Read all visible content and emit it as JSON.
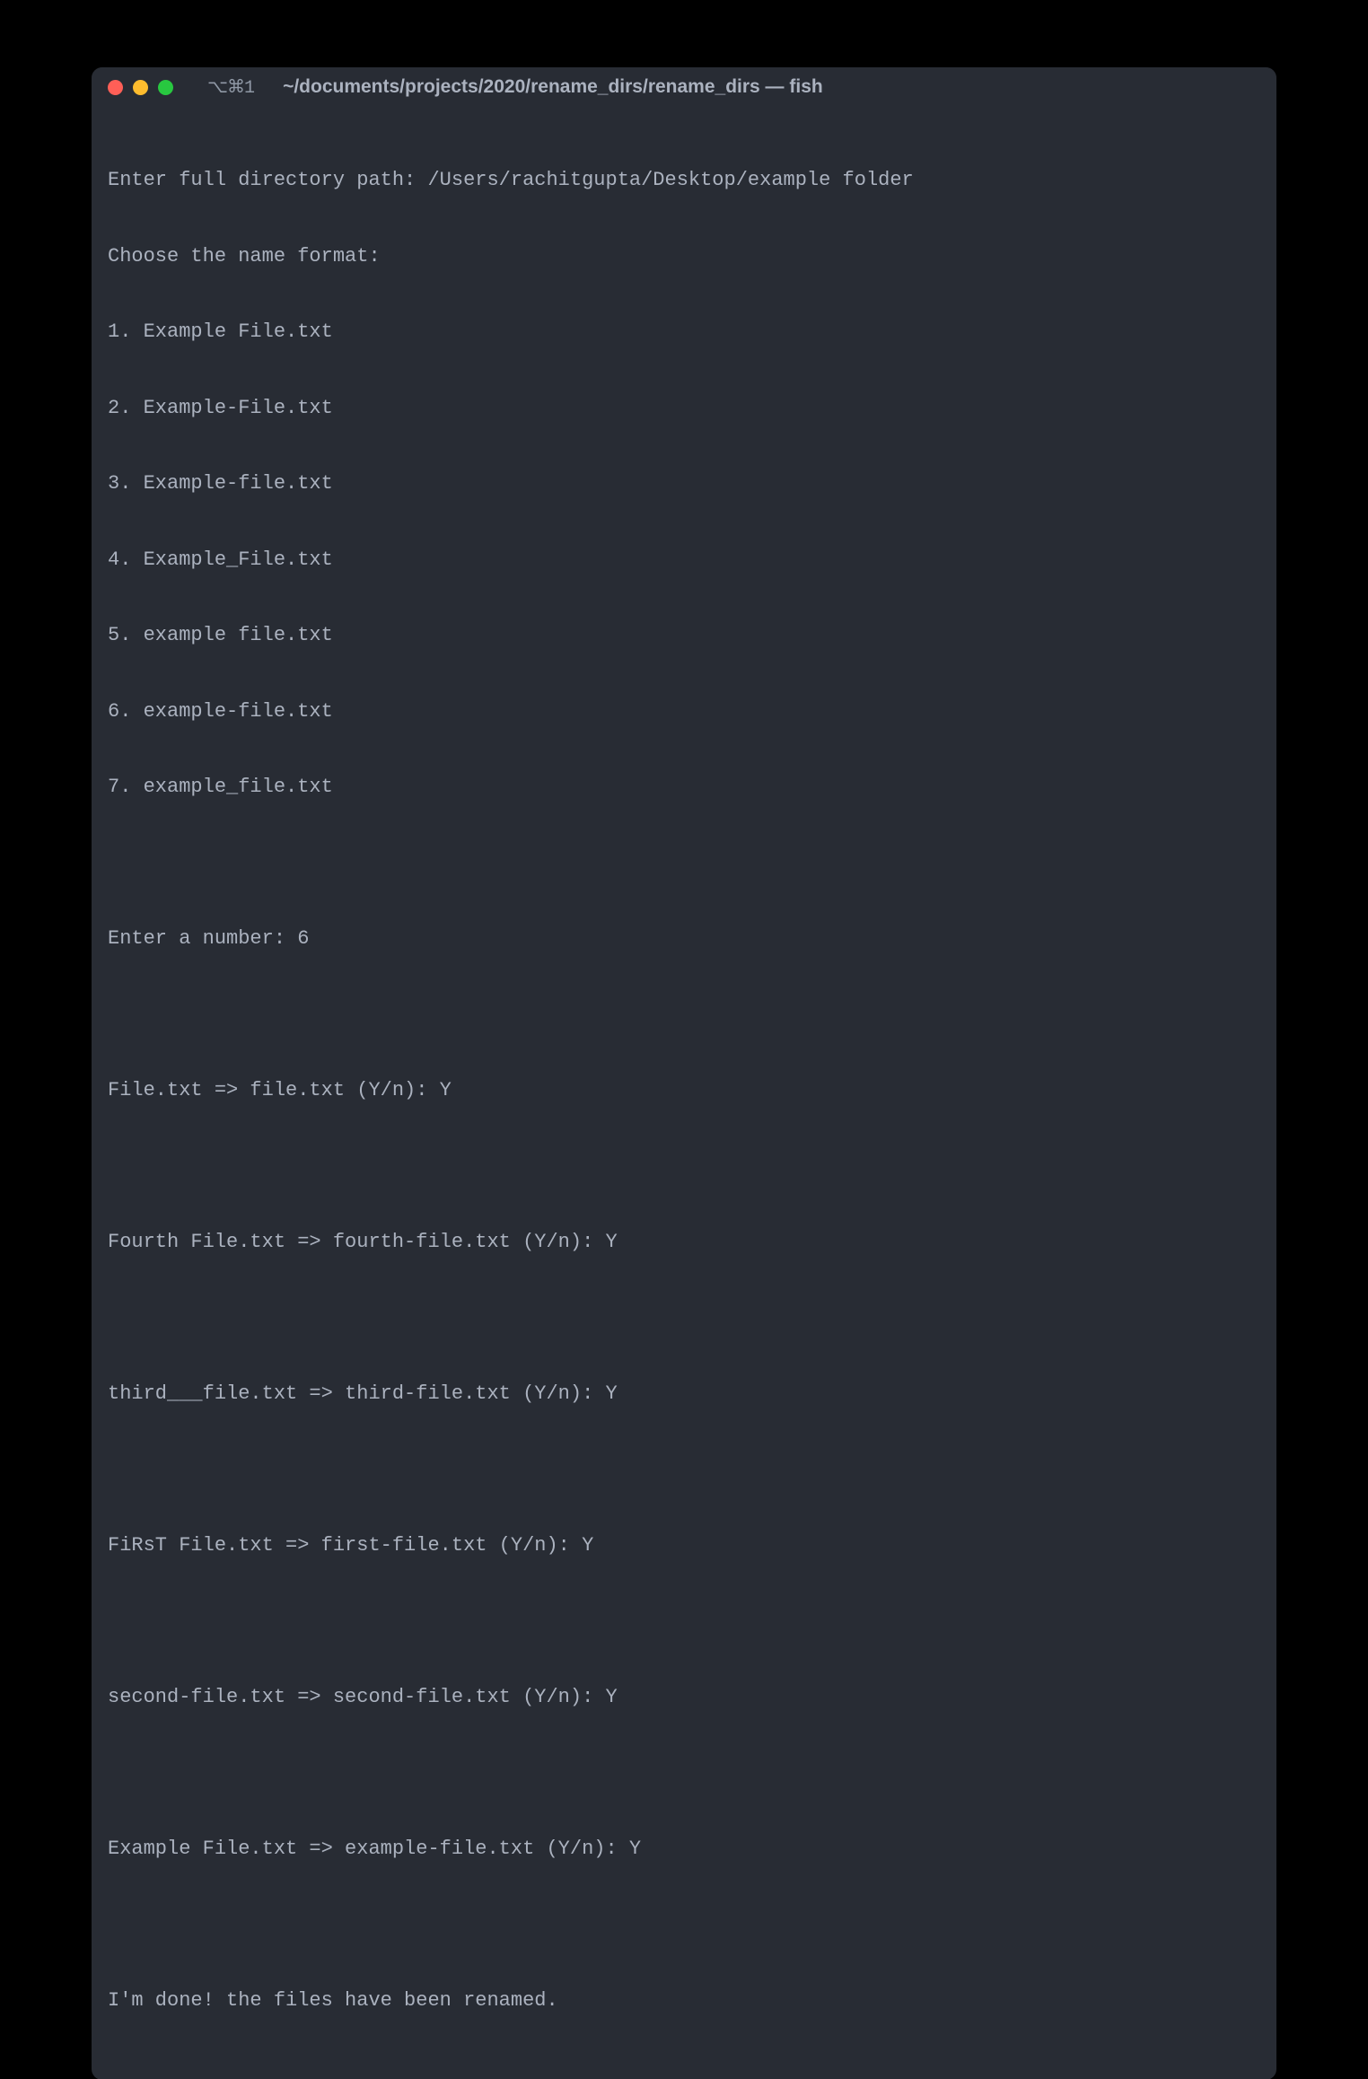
{
  "titlebar": {
    "shortcut": "⌥⌘1",
    "title": "~/documents/projects/2020/rename_dirs/rename_dirs — fish"
  },
  "lines": {
    "l0": "Enter full directory path: /Users/rachitgupta/Desktop/example folder",
    "l1": "Choose the name format:",
    "l2": "1. Example File.txt",
    "l3": "2. Example-File.txt",
    "l4": "3. Example-file.txt",
    "l5": "4. Example_File.txt",
    "l6": "5. example file.txt",
    "l7": "6. example-file.txt",
    "l8": "7. example_file.txt",
    "l9": "",
    "l10": "Enter a number: 6",
    "l11": "",
    "l12": "File.txt => file.txt (Y/n): Y",
    "l13": "",
    "l14": "Fourth File.txt => fourth-file.txt (Y/n): Y",
    "l15": "",
    "l16": "third___file.txt => third-file.txt (Y/n): Y",
    "l17": "",
    "l18": "FiRsT File.txt => first-file.txt (Y/n): Y",
    "l19": "",
    "l20": "second-file.txt => second-file.txt (Y/n): Y",
    "l21": "",
    "l22": "Example File.txt => example-file.txt (Y/n): Y",
    "l23": "",
    "l24": "I'm done! the files have been renamed."
  }
}
